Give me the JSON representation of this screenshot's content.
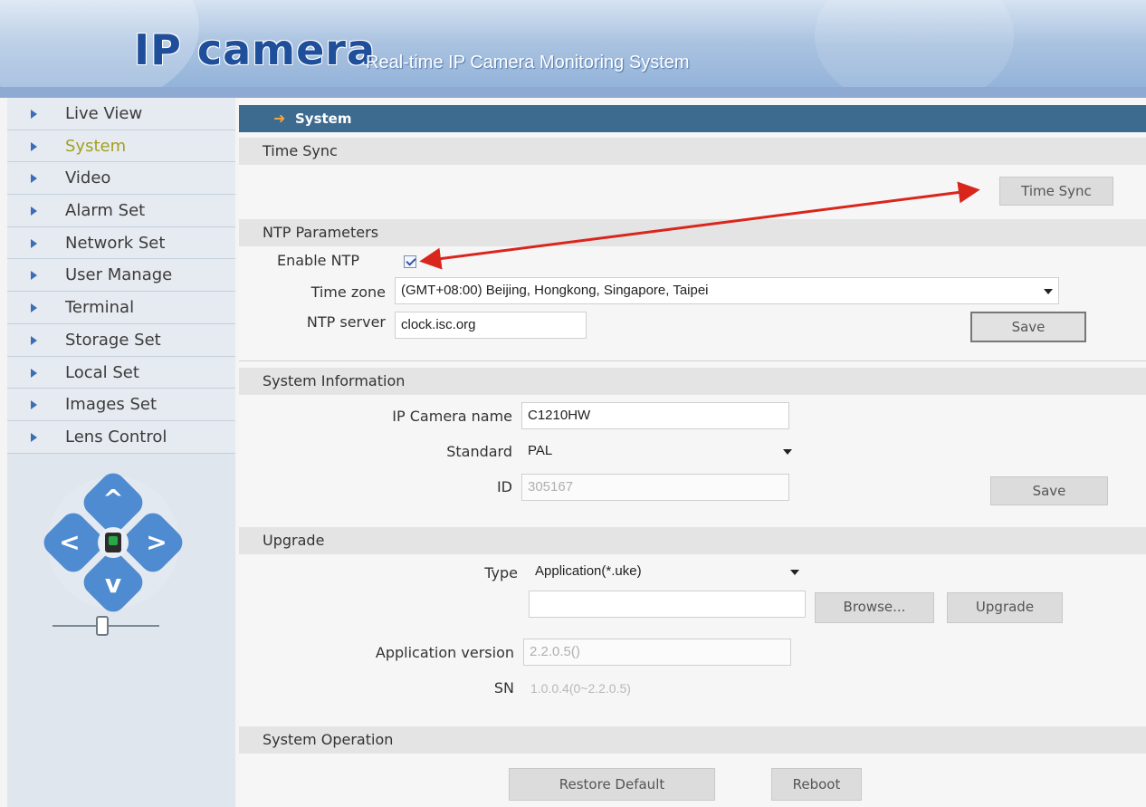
{
  "header": {
    "brand": "IP camera",
    "tagline": "Real-time IP Camera Monitoring System"
  },
  "sidebar": {
    "items": [
      {
        "label": "Live View"
      },
      {
        "label": "System"
      },
      {
        "label": "Video"
      },
      {
        "label": "Alarm Set"
      },
      {
        "label": "Network Set"
      },
      {
        "label": "User Manage"
      },
      {
        "label": "Terminal"
      },
      {
        "label": "Storage Set"
      },
      {
        "label": "Local Set"
      },
      {
        "label": "Images Set"
      },
      {
        "label": "Lens Control"
      }
    ],
    "active": "System",
    "ptz": {
      "up": "^",
      "down": "v",
      "left": "<",
      "right": ">"
    }
  },
  "main": {
    "title": "System",
    "time_sync": {
      "heading": "Time Sync",
      "button": "Time Sync"
    },
    "ntp": {
      "heading": "NTP Parameters",
      "enable_label": "Enable NTP",
      "enable_checked": true,
      "timezone_label": "Time zone",
      "timezone_value": "(GMT+08:00) Beijing, Hongkong, Singapore, Taipei",
      "server_label": "NTP server",
      "server_value": "clock.isc.org",
      "save": "Save"
    },
    "system_info": {
      "heading": "System Information",
      "name_label": "IP Camera name",
      "name_value": "C1210HW",
      "standard_label": "Standard",
      "standard_value": "PAL",
      "id_label": "ID",
      "id_value": "305167",
      "save": "Save"
    },
    "upgrade": {
      "heading": "Upgrade",
      "type_label": "Type",
      "type_value": "Application(*.uke)",
      "file_value": "",
      "browse": "Browse...",
      "upgrade": "Upgrade",
      "app_version_label": "Application version",
      "app_version_value": "2.2.0.5()",
      "sn_label": "SN",
      "sn_value": "1.0.0.4(0~2.2.0.5)"
    },
    "system_operation": {
      "heading": "System Operation",
      "restore": "Restore Default",
      "reboot": "Reboot"
    }
  },
  "colors": {
    "title_bar": "#3d6a8f",
    "accent_active": "#a3a01f",
    "annotation_arrow": "#d9261c"
  }
}
